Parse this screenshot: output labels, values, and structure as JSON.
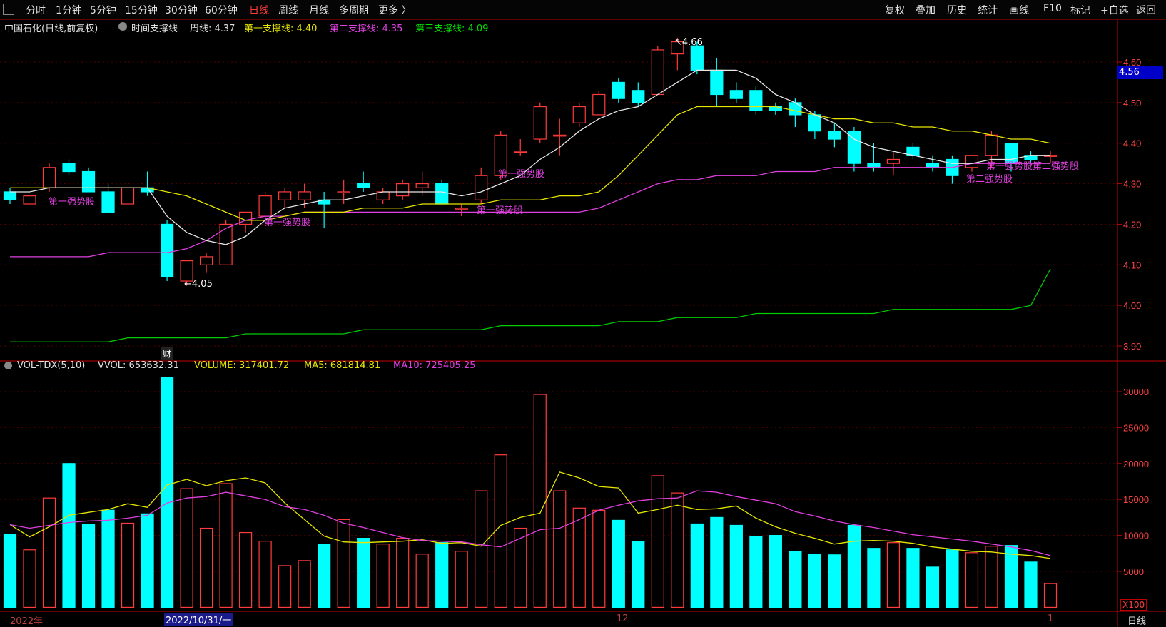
{
  "toolbar": {
    "left": [
      "分时",
      "1分钟",
      "5分钟",
      "15分钟",
      "30分钟",
      "60分钟",
      "日线",
      "周线",
      "月线",
      "多周期",
      "更多 〉"
    ],
    "active_index": 6,
    "right": [
      "复权",
      "叠加",
      "历史",
      "统计",
      "画线",
      "F10",
      "标记",
      "+自选",
      "返回"
    ]
  },
  "price_header": {
    "stock": "中国石化(日线,前复权)",
    "indicator": "时间支撑线",
    "week_line": "周线: 4.37",
    "support1": "第一支撑线: 4.40",
    "support2": "第二支撑线: 4.35",
    "support3": "第三支撑线: 4.09"
  },
  "vol_header": {
    "name": "VOL-TDX(5,10)",
    "vvol": "VVOL: 653632.31",
    "volume": "VOLUME: 317401.72",
    "ma5": "MA5: 681814.81",
    "ma10": "MA10: 725405.25"
  },
  "annotations": {
    "high": "4.66",
    "low": "4.05",
    "cai": "财",
    "strong1": "第一强势股",
    "strong2": "第二强势股",
    "strong_mix": "第一强势股第二强势股"
  },
  "current_price": "4.56",
  "x_labels": {
    "year": "2022年",
    "date": "2022/10/31/一",
    "m12": "12",
    "m1": "1",
    "period": "日线",
    "unit": "X100"
  },
  "colors": {
    "up": "#ff3b3b",
    "down": "#00ffff",
    "ma_white": "#e6e6e6",
    "yellow": "#e6e600",
    "magenta": "#e040e0",
    "green": "#00cc00",
    "axis": "#c00000"
  },
  "chart_data": [
    {
      "type": "candlestick",
      "title": "中国石化(日线,前复权)",
      "ylim": [
        3.88,
        4.7
      ],
      "yticks": [
        "4.60",
        "4.50",
        "4.40",
        "4.30",
        "4.20",
        "4.10",
        "4.00",
        "3.90"
      ],
      "candles": [
        {
          "o": 4.28,
          "h": 4.29,
          "l": 4.25,
          "c": 4.26
        },
        {
          "o": 4.25,
          "h": 4.27,
          "l": 4.25,
          "c": 4.27
        },
        {
          "o": 4.29,
          "h": 4.35,
          "l": 4.28,
          "c": 4.34
        },
        {
          "o": 4.35,
          "h": 4.36,
          "l": 4.32,
          "c": 4.33
        },
        {
          "o": 4.33,
          "h": 4.34,
          "l": 4.28,
          "c": 4.28
        },
        {
          "o": 4.28,
          "h": 4.3,
          "l": 4.23,
          "c": 4.23
        },
        {
          "o": 4.25,
          "h": 4.29,
          "l": 4.25,
          "c": 4.29
        },
        {
          "o": 4.29,
          "h": 4.33,
          "l": 4.27,
          "c": 4.28
        },
        {
          "o": 4.2,
          "h": 4.21,
          "l": 4.06,
          "c": 4.07
        },
        {
          "o": 4.06,
          "h": 4.11,
          "l": 4.05,
          "c": 4.11
        },
        {
          "o": 4.1,
          "h": 4.13,
          "l": 4.08,
          "c": 4.12
        },
        {
          "o": 4.1,
          "h": 4.21,
          "l": 4.1,
          "c": 4.2
        },
        {
          "o": 4.2,
          "h": 4.23,
          "l": 4.18,
          "c": 4.23
        },
        {
          "o": 4.22,
          "h": 4.28,
          "l": 4.21,
          "c": 4.27
        },
        {
          "o": 4.26,
          "h": 4.29,
          "l": 4.24,
          "c": 4.28
        },
        {
          "o": 4.26,
          "h": 4.3,
          "l": 4.24,
          "c": 4.28
        },
        {
          "o": 4.26,
          "h": 4.28,
          "l": 4.19,
          "c": 4.25
        },
        {
          "o": 4.28,
          "h": 4.31,
          "l": 4.25,
          "c": 4.28
        },
        {
          "o": 4.3,
          "h": 4.33,
          "l": 4.28,
          "c": 4.29
        },
        {
          "o": 4.26,
          "h": 4.29,
          "l": 4.25,
          "c": 4.28
        },
        {
          "o": 4.27,
          "h": 4.31,
          "l": 4.26,
          "c": 4.3
        },
        {
          "o": 4.29,
          "h": 4.33,
          "l": 4.27,
          "c": 4.3
        },
        {
          "o": 4.3,
          "h": 4.31,
          "l": 4.25,
          "c": 4.25
        },
        {
          "o": 4.24,
          "h": 4.25,
          "l": 4.22,
          "c": 4.24
        },
        {
          "o": 4.26,
          "h": 4.34,
          "l": 4.25,
          "c": 4.32
        },
        {
          "o": 4.32,
          "h": 4.43,
          "l": 4.31,
          "c": 4.42
        },
        {
          "o": 4.38,
          "h": 4.41,
          "l": 4.37,
          "c": 4.38
        },
        {
          "o": 4.41,
          "h": 4.5,
          "l": 4.4,
          "c": 4.49
        },
        {
          "o": 4.42,
          "h": 4.46,
          "l": 4.37,
          "c": 4.42
        },
        {
          "o": 4.45,
          "h": 4.5,
          "l": 4.44,
          "c": 4.49
        },
        {
          "o": 4.47,
          "h": 4.53,
          "l": 4.47,
          "c": 4.52
        },
        {
          "o": 4.55,
          "h": 4.56,
          "l": 4.5,
          "c": 4.51
        },
        {
          "o": 4.53,
          "h": 4.55,
          "l": 4.49,
          "c": 4.5
        },
        {
          "o": 4.52,
          "h": 4.64,
          "l": 4.52,
          "c": 4.63
        },
        {
          "o": 4.62,
          "h": 4.66,
          "l": 4.58,
          "c": 4.65
        },
        {
          "o": 4.64,
          "h": 4.65,
          "l": 4.57,
          "c": 4.58
        },
        {
          "o": 4.58,
          "h": 4.61,
          "l": 4.49,
          "c": 4.52
        },
        {
          "o": 4.53,
          "h": 4.55,
          "l": 4.5,
          "c": 4.51
        },
        {
          "o": 4.53,
          "h": 4.54,
          "l": 4.47,
          "c": 4.48
        },
        {
          "o": 4.49,
          "h": 4.5,
          "l": 4.47,
          "c": 4.48
        },
        {
          "o": 4.5,
          "h": 4.51,
          "l": 4.44,
          "c": 4.47
        },
        {
          "o": 4.47,
          "h": 4.48,
          "l": 4.41,
          "c": 4.43
        },
        {
          "o": 4.43,
          "h": 4.45,
          "l": 4.39,
          "c": 4.41
        },
        {
          "o": 4.43,
          "h": 4.44,
          "l": 4.33,
          "c": 4.35
        },
        {
          "o": 4.35,
          "h": 4.4,
          "l": 4.33,
          "c": 4.34
        },
        {
          "o": 4.35,
          "h": 4.38,
          "l": 4.32,
          "c": 4.36
        },
        {
          "o": 4.39,
          "h": 4.4,
          "l": 4.36,
          "c": 4.37
        },
        {
          "o": 4.35,
          "h": 4.37,
          "l": 4.33,
          "c": 4.34
        },
        {
          "o": 4.36,
          "h": 4.37,
          "l": 4.3,
          "c": 4.32
        },
        {
          "o": 4.34,
          "h": 4.37,
          "l": 4.33,
          "c": 4.37
        },
        {
          "o": 4.37,
          "h": 4.43,
          "l": 4.34,
          "c": 4.42
        },
        {
          "o": 4.4,
          "h": 4.4,
          "l": 4.33,
          "c": 4.35
        },
        {
          "o": 4.37,
          "h": 4.38,
          "l": 4.35,
          "c": 4.36
        },
        {
          "o": 4.37,
          "h": 4.38,
          "l": 4.35,
          "c": 4.37
        }
      ],
      "ma_white": [
        4.28,
        4.28,
        4.29,
        4.29,
        4.29,
        4.29,
        4.29,
        4.29,
        4.22,
        4.18,
        4.16,
        4.15,
        4.17,
        4.21,
        4.24,
        4.25,
        4.26,
        4.26,
        4.27,
        4.28,
        4.28,
        4.28,
        4.28,
        4.27,
        4.28,
        4.3,
        4.32,
        4.36,
        4.39,
        4.43,
        4.46,
        4.48,
        4.49,
        4.52,
        4.55,
        4.58,
        4.58,
        4.58,
        4.56,
        4.52,
        4.5,
        4.47,
        4.45,
        4.41,
        4.39,
        4.38,
        4.37,
        4.36,
        4.35,
        4.35,
        4.36,
        4.36,
        4.37,
        4.37
      ],
      "week_line": [
        4.29,
        4.29,
        4.29,
        4.29,
        4.29,
        4.29,
        4.29,
        4.29,
        4.28,
        4.27,
        4.25,
        4.23,
        4.21,
        4.21,
        4.22,
        4.23,
        4.23,
        4.23,
        4.24,
        4.24,
        4.24,
        4.25,
        4.25,
        4.25,
        4.25,
        4.26,
        4.26,
        4.26,
        4.27,
        4.27,
        4.28,
        4.32,
        4.37,
        4.42,
        4.47,
        4.49,
        4.49,
        4.49,
        4.49,
        4.49,
        4.48,
        4.47,
        4.46,
        4.46,
        4.45,
        4.45,
        4.44,
        4.44,
        4.43,
        4.43,
        4.42,
        4.41,
        4.41,
        4.4
      ],
      "line_magenta": [
        4.12,
        4.12,
        4.12,
        4.12,
        4.12,
        4.13,
        4.13,
        4.13,
        4.13,
        4.14,
        4.16,
        4.19,
        4.21,
        4.22,
        4.22,
        4.23,
        4.23,
        4.23,
        4.23,
        4.23,
        4.23,
        4.23,
        4.23,
        4.23,
        4.23,
        4.23,
        4.23,
        4.23,
        4.23,
        4.23,
        4.24,
        4.26,
        4.28,
        4.3,
        4.31,
        4.31,
        4.32,
        4.32,
        4.32,
        4.33,
        4.33,
        4.33,
        4.34,
        4.34,
        4.34,
        4.34,
        4.34,
        4.34,
        4.34,
        4.35,
        4.35,
        4.35,
        4.35,
        4.35
      ],
      "line_green": [
        3.91,
        3.91,
        3.91,
        3.91,
        3.91,
        3.91,
        3.92,
        3.92,
        3.92,
        3.92,
        3.92,
        3.92,
        3.93,
        3.93,
        3.93,
        3.93,
        3.93,
        3.93,
        3.94,
        3.94,
        3.94,
        3.94,
        3.94,
        3.94,
        3.94,
        3.95,
        3.95,
        3.95,
        3.95,
        3.95,
        3.95,
        3.96,
        3.96,
        3.96,
        3.97,
        3.97,
        3.97,
        3.97,
        3.98,
        3.98,
        3.98,
        3.98,
        3.98,
        3.98,
        3.98,
        3.99,
        3.99,
        3.99,
        3.99,
        3.99,
        3.99,
        3.99,
        4.0,
        4.09
      ]
    },
    {
      "type": "bar",
      "title": "VOL-TDX(5,10)",
      "unit": "X100",
      "ylim": [
        0,
        34000
      ],
      "yticks": [
        "30000",
        "25000",
        "20000",
        "15000",
        "10000",
        "5000"
      ],
      "volumes": [
        10200,
        8000,
        15200,
        20000,
        11500,
        13500,
        11700,
        13000,
        32000,
        16500,
        11000,
        17200,
        10400,
        9200,
        5800,
        6500,
        8800,
        12200,
        9600,
        8800,
        9600,
        7400,
        9000,
        7800,
        16200,
        21200,
        11000,
        29600,
        16200,
        13800,
        13500,
        12100,
        9200,
        18300,
        15900,
        11600,
        12500,
        11400,
        9900,
        10000,
        7800,
        7400,
        7300,
        11400,
        8200,
        9000,
        8200,
        5600,
        8000,
        7600,
        8500,
        8600,
        6300,
        3300
      ],
      "ma5": [
        11500,
        9800,
        11200,
        12800,
        13200,
        13600,
        14400,
        13900,
        17000,
        17800,
        16900,
        17600,
        18000,
        17300,
        14500,
        12200,
        9900,
        9100,
        9000,
        9100,
        9200,
        9400,
        8900,
        9000,
        8500,
        11400,
        12500,
        13100,
        18800,
        18000,
        16800,
        16600,
        13100,
        13600,
        14200,
        13600,
        13700,
        14100,
        12400,
        11200,
        10300,
        9600,
        8800,
        9200,
        9300,
        9200,
        8900,
        8400,
        8100,
        7800,
        7700,
        7400,
        7200,
        6800
      ],
      "ma10": [
        11500,
        11000,
        11400,
        11800,
        12000,
        12100,
        12400,
        12800,
        14500,
        15200,
        15400,
        16000,
        15500,
        15000,
        14000,
        13600,
        12800,
        11700,
        11100,
        10400,
        9700,
        9300,
        9200,
        9100,
        8700,
        8400,
        9600,
        10800,
        11000,
        12200,
        13500,
        14200,
        14800,
        15100,
        15200,
        16200,
        16000,
        15400,
        14900,
        14400,
        13300,
        12700,
        12000,
        11500,
        11100,
        10600,
        10100,
        9800,
        9500,
        9200,
        8800,
        8400,
        7900,
        7200
      ]
    }
  ]
}
